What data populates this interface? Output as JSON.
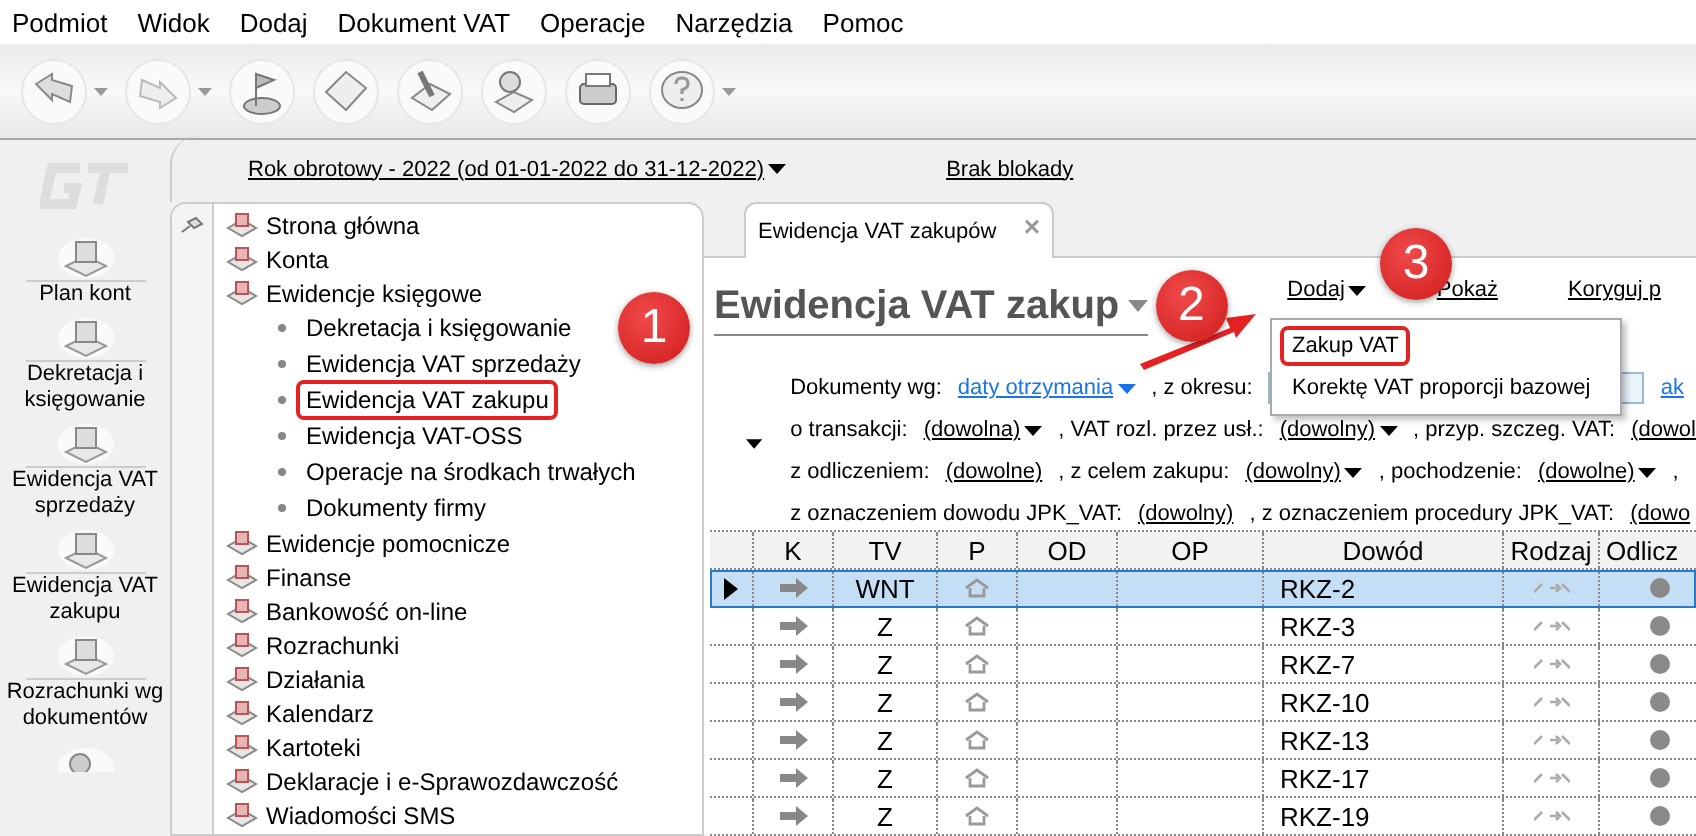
{
  "menu_bar": [
    "Podmiot",
    "Widok",
    "Dodaj",
    "Dokument VAT",
    "Operacje",
    "Narzędzia",
    "Pomoc"
  ],
  "fiscal_year": "Rok obrotowy - 2022  (od 01-01-2022 do 31-12-2022)",
  "lock_status": "Brak blokady",
  "shortcuts": [
    "Plan kont",
    "Dekretacja i księgowanie",
    "Ewidencja VAT sprzedaży",
    "Ewidencja VAT zakupu",
    "Rozrachunki wg dokumentów"
  ],
  "tree": [
    {
      "label": "Strona główna"
    },
    {
      "label": "Konta"
    },
    {
      "label": "Ewidencje księgowe",
      "children": [
        {
          "label": "Dekretacja i księgowanie",
          "highlighted": false
        },
        {
          "label": "Ewidencja VAT sprzedaży",
          "highlighted": false
        },
        {
          "label": "Ewidencja VAT zakupu",
          "highlighted": true,
          "callout": "1"
        },
        {
          "label": "Ewidencja VAT-OSS",
          "highlighted": false
        },
        {
          "label": "Operacje na środkach trwałych",
          "highlighted": false
        },
        {
          "label": "Dokumenty firmy",
          "highlighted": false
        }
      ]
    },
    {
      "label": "Ewidencje pomocnicze"
    },
    {
      "label": "Finanse"
    },
    {
      "label": "Bankowość on-line"
    },
    {
      "label": "Rozrachunki"
    },
    {
      "label": "Działania"
    },
    {
      "label": "Kalendarz"
    },
    {
      "label": "Kartoteki"
    },
    {
      "label": "Deklaracje i e-Sprawozdawczość"
    },
    {
      "label": "Wiadomości SMS"
    }
  ],
  "tab": {
    "label": "Ewidencja VAT zakupów",
    "close": "×"
  },
  "heading": {
    "title": "Ewidencja VAT zakup",
    "callout": "2"
  },
  "actions": [
    "Dodaj",
    "Pokaż",
    "Koryguj p"
  ],
  "add_menu": {
    "callout": "3",
    "items": [
      {
        "label": "Zakup VAT",
        "highlighted": true
      },
      {
        "label": "Korektę VAT proporcji bazowej",
        "highlighted": false
      }
    ]
  },
  "filters": [
    [
      {
        "kind": "label",
        "text": "Dokumenty wg:"
      },
      {
        "kind": "dropdown",
        "text": "daty otrzymania",
        "accent": true
      },
      {
        "kind": "label",
        "text": ", z okresu:"
      },
      {
        "kind": "field"
      },
      {
        "kind": "link",
        "text": "ak",
        "accent": true
      }
    ],
    [
      {
        "kind": "label",
        "text": "o transakcji:"
      },
      {
        "kind": "dropdown",
        "text": "(dowolna)",
        "accent": false
      },
      {
        "kind": "label",
        "text": ", VAT rozl. przez usł.:"
      },
      {
        "kind": "dropdown",
        "text": "(dowolny)",
        "accent": false
      },
      {
        "kind": "label",
        "text": ", przyp. szczeg. VAT:"
      },
      {
        "kind": "link",
        "text": "(dowol",
        "accent": false
      }
    ],
    [
      {
        "kind": "label",
        "text": "z odliczeniem:"
      },
      {
        "kind": "link",
        "text": "(dowolne)",
        "accent": false
      },
      {
        "kind": "label",
        "text": ", z celem zakupu:"
      },
      {
        "kind": "dropdown",
        "text": "(dowolny)",
        "accent": false
      },
      {
        "kind": "label",
        "text": ", pochodzenie:"
      },
      {
        "kind": "dropdown",
        "text": "(dowolne)",
        "accent": false
      },
      {
        "kind": "label",
        "text": ","
      }
    ],
    [
      {
        "kind": "label",
        "text": "z oznaczeniem dowodu JPK_VAT:"
      },
      {
        "kind": "link",
        "text": "(dowolny)",
        "accent": false
      },
      {
        "kind": "label",
        "text": ", z oznaczeniem procedury JPK_VAT:"
      },
      {
        "kind": "link",
        "text": "(dowo",
        "accent": false
      }
    ]
  ],
  "table": {
    "columns": [
      "K",
      "TV",
      "P",
      "OD",
      "OP",
      "Dowód",
      "Rodzaj",
      "Odlicz"
    ],
    "rows": [
      {
        "tv": "WNT",
        "dowod": "RKZ-2",
        "selected": true
      },
      {
        "tv": "Z",
        "dowod": "RKZ-3",
        "selected": false
      },
      {
        "tv": "Z",
        "dowod": "RKZ-7",
        "selected": false
      },
      {
        "tv": "Z",
        "dowod": "RKZ-10",
        "selected": false
      },
      {
        "tv": "Z",
        "dowod": "RKZ-13",
        "selected": false
      },
      {
        "tv": "Z",
        "dowod": "RKZ-17",
        "selected": false
      },
      {
        "tv": "Z",
        "dowod": "RKZ-19",
        "selected": false
      }
    ]
  }
}
